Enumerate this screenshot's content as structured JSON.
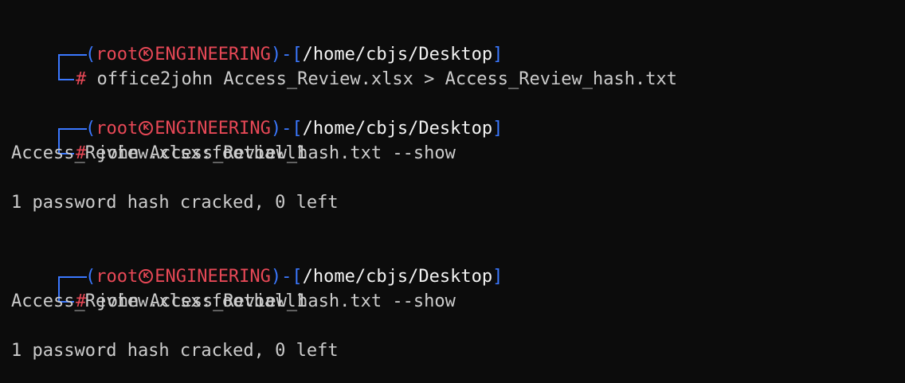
{
  "prompt": {
    "user": "root",
    "host": "ENGINEERING",
    "path": "/home/cbjs/Desktop",
    "open_paren": "(",
    "close_paren": ")",
    "dash": "-",
    "open_bracket": "[",
    "close_bracket": "]",
    "symbol": "#",
    "separator_glyph": "K"
  },
  "blocks": [
    {
      "command": "office2john Access_Review.xlsx > Access_Review_hash.txt",
      "output": []
    },
    {
      "command": "john Access_Review_hash.txt --show",
      "output": [
        "Access_Review.xlsx:football1",
        "",
        "1 password hash cracked, 0 left"
      ]
    },
    {
      "command": "john Access_Review_hash.txt --show",
      "output": [
        "Access_Review.xlsx:football1",
        "",
        "1 password hash cracked, 0 left"
      ]
    }
  ],
  "colors": {
    "background": "#0c0c0c",
    "blue": "#3b78ff",
    "red": "#e74856",
    "text": "#cccccc"
  }
}
